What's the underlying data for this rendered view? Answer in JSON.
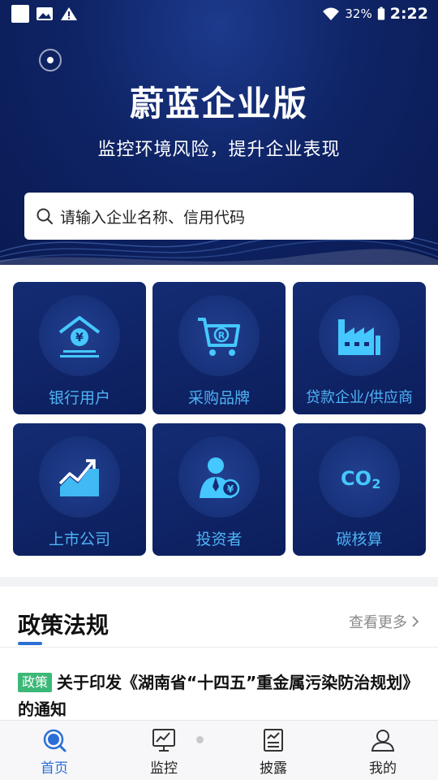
{
  "status_bar": {
    "battery": "32%",
    "time": "2:22"
  },
  "hero": {
    "title": "蔚蓝企业版",
    "subtitle": "监控环境风险，提升企业表现"
  },
  "search": {
    "placeholder": "请输入企业名称、信用代码",
    "icon": "search-icon"
  },
  "categories": [
    {
      "label": "银行用户",
      "icon": "bank-icon"
    },
    {
      "label": "采购品牌",
      "icon": "shopping-cart-icon"
    },
    {
      "label": "贷款企业/供应商",
      "icon": "factory-icon"
    },
    {
      "label": "上市公司",
      "icon": "stock-chart-icon"
    },
    {
      "label": "投资者",
      "icon": "investor-icon"
    },
    {
      "label": "碳核算",
      "icon": "co2-icon"
    }
  ],
  "policy": {
    "title": "政策法规",
    "more_label": "查看更多",
    "news": [
      {
        "tag": "政策",
        "title": "关于印发《湖南省“十四五”重金属污染防治规划》的通知"
      }
    ]
  },
  "bottom_nav": [
    {
      "label": "首页",
      "icon": "home-search-icon",
      "active": true
    },
    {
      "label": "监控",
      "icon": "monitor-icon",
      "active": false
    },
    {
      "label": "披露",
      "icon": "report-icon",
      "active": false
    },
    {
      "label": "我的",
      "icon": "user-icon",
      "active": false
    }
  ],
  "colors": {
    "hero_bg": "#0f2466",
    "tile_bg": "#0c1e5c",
    "tile_label": "#4fb3f5",
    "accent": "#2a6fd6",
    "tag_green": "#3cb878"
  }
}
